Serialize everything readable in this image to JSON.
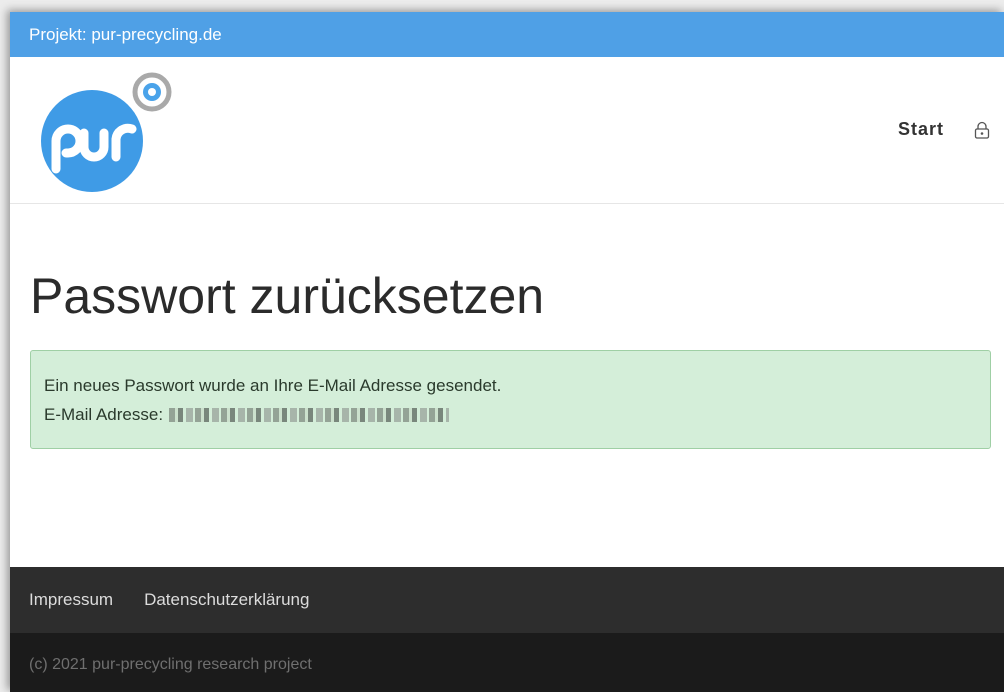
{
  "project_bar": {
    "label": "Projekt: pur-precycling.de"
  },
  "logo": {
    "text": "pur"
  },
  "nav": {
    "start_label": "Start",
    "lock_icon": "lock-icon"
  },
  "main": {
    "title": "Passwort zurücksetzen",
    "alert": {
      "message": "Ein neues Passwort wurde an Ihre E-Mail Adresse gesendet.",
      "email_label": "E-Mail Adresse:"
    }
  },
  "footer": {
    "links": [
      "Impressum",
      "Datenschutzerklärung"
    ],
    "copyright": "(c) 2021 pur-precycling research project"
  },
  "colors": {
    "project_bar": "#4fa0e6",
    "logo_blue": "#3f9be6",
    "alert_bg": "#d4eed9",
    "alert_border": "#9fcfa5",
    "footer_top": "#2d2d2d",
    "footer_bottom": "#1b1b1b"
  }
}
